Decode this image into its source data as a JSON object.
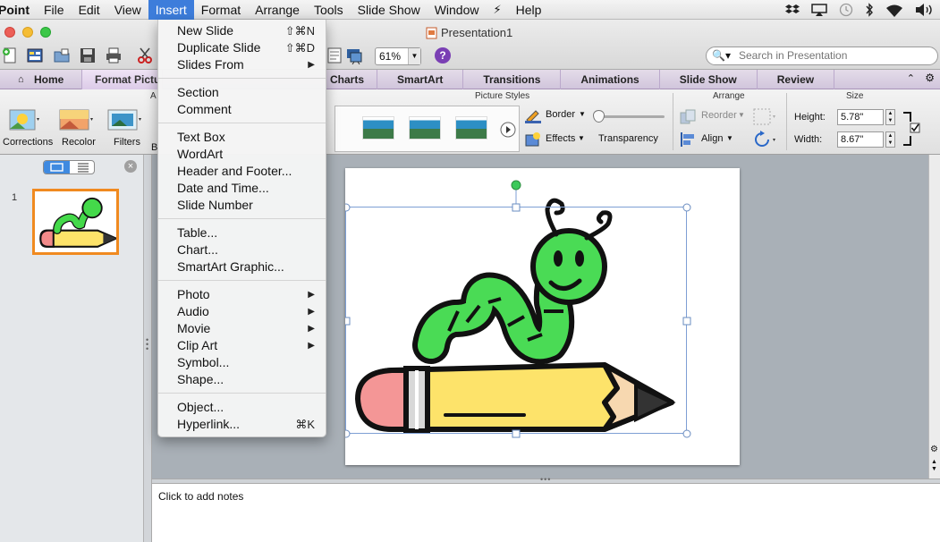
{
  "menubar": {
    "items": [
      "Point",
      "File",
      "Edit",
      "View",
      "Insert",
      "Format",
      "Arrange",
      "Tools",
      "Slide Show",
      "Window",
      "Help"
    ],
    "active": "Insert"
  },
  "window": {
    "title": "Presentation1",
    "zoom": "61%"
  },
  "search": {
    "placeholder": "Search in Presentation"
  },
  "tabs": {
    "home": "Home",
    "format_picture": "Format Pictu",
    "charts": "Charts",
    "smartart": "SmartArt",
    "transitions": "Transitions",
    "animations": "Animations",
    "slide_show": "Slide Show",
    "review": "Review"
  },
  "ribbon": {
    "adjust_title": "A",
    "corrections": "Corrections",
    "recolor": "Recolor",
    "filters": "Filters",
    "b_cut": "B",
    "picture_styles_title": "Picture Styles",
    "border": "Border",
    "effects": "Effects",
    "transparency": "Transparency",
    "arrange_title": "Arrange",
    "reorder": "Reorder",
    "align": "Align",
    "size_title": "Size",
    "height_label": "Height:",
    "height_value": "5.78\"",
    "width_label": "Width:",
    "width_value": "8.67\""
  },
  "insert_menu": {
    "group1": [
      {
        "label": "New Slide",
        "shortcut": "⇧⌘N"
      },
      {
        "label": "Duplicate Slide",
        "shortcut": "⇧⌘D"
      },
      {
        "label": "Slides From",
        "submenu": "▶"
      }
    ],
    "group2": [
      {
        "label": "Section"
      },
      {
        "label": "Comment"
      }
    ],
    "group3": [
      {
        "label": "Text Box"
      },
      {
        "label": "WordArt"
      },
      {
        "label": "Header and Footer..."
      },
      {
        "label": "Date and Time..."
      },
      {
        "label": "Slide Number"
      }
    ],
    "group4": [
      {
        "label": "Table..."
      },
      {
        "label": "Chart..."
      },
      {
        "label": "SmartArt Graphic..."
      }
    ],
    "group5": [
      {
        "label": "Photo",
        "submenu": "▶"
      },
      {
        "label": "Audio",
        "submenu": "▶"
      },
      {
        "label": "Movie",
        "submenu": "▶"
      },
      {
        "label": "Clip Art",
        "submenu": "▶"
      },
      {
        "label": "Symbol..."
      },
      {
        "label": "Shape..."
      }
    ],
    "group6": [
      {
        "label": "Object..."
      },
      {
        "label": "Hyperlink...",
        "shortcut": "⌘K"
      }
    ]
  },
  "slides_pane": {
    "slide_number": "1"
  },
  "notes": {
    "placeholder": "Click to add notes"
  },
  "colors": {
    "accent": "#3d7ddb",
    "thumb_border": "#f08a20",
    "ribbon_tab": "#d1c5dc"
  }
}
